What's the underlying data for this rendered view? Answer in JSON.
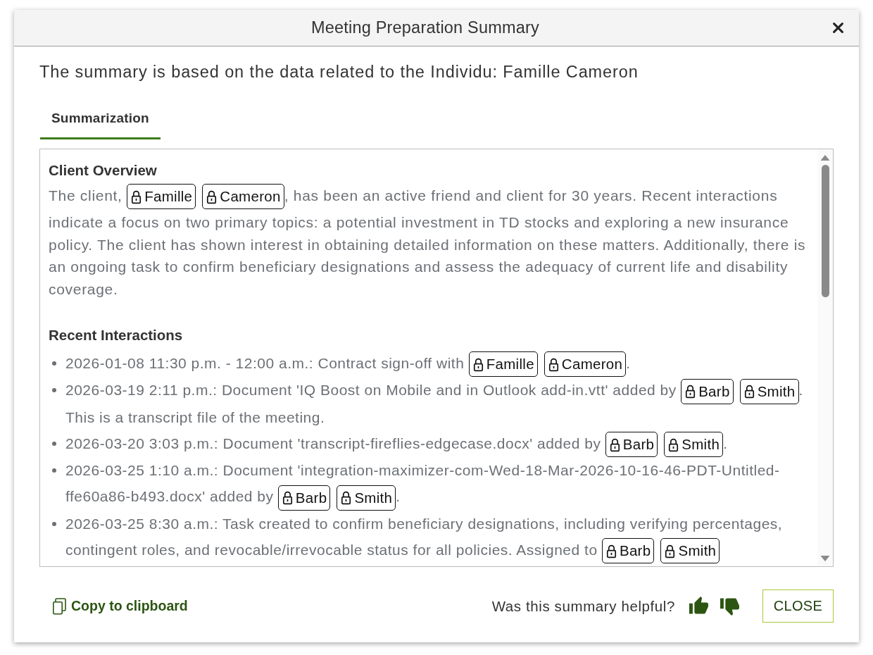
{
  "dialog": {
    "title": "Meeting Preparation Summary"
  },
  "subtitle": "The summary is based on the data related to the Individu: Famille Cameron",
  "tabs": [
    {
      "label": "Summarization",
      "selected": true
    }
  ],
  "summary": {
    "sections": [
      {
        "kind": "paragraph",
        "heading": "Client Overview",
        "parts": [
          {
            "kind": "text",
            "text": "The client, "
          },
          {
            "kind": "tag",
            "text": "Famille"
          },
          {
            "kind": "tag",
            "text": "Cameron"
          },
          {
            "kind": "text",
            "text": ", has been an active friend and client for 30 years. Recent interactions indicate a focus on two primary topics: a potential investment in TD stocks and exploring a new insurance policy. The client has shown interest in obtaining detailed information on these matters. Additionally, there is an ongoing task to confirm beneficiary designations and assess the adequacy of current life and disability coverage."
          }
        ]
      },
      {
        "kind": "list",
        "heading": "Recent Interactions",
        "items": [
          {
            "parts": [
              {
                "kind": "text",
                "text": "2026-01-08 11:30 p.m. - 12:00 a.m.: Contract sign-off with "
              },
              {
                "kind": "tag",
                "text": "Famille"
              },
              {
                "kind": "tag",
                "text": "Cameron"
              },
              {
                "kind": "text",
                "text": "."
              }
            ]
          },
          {
            "parts": [
              {
                "kind": "text",
                "text": "2026-03-19 2:11 p.m.: Document 'IQ Boost on Mobile and in Outlook add-in.vtt' added by "
              },
              {
                "kind": "tag",
                "text": "Barb"
              },
              {
                "kind": "tag",
                "text": "Smith"
              },
              {
                "kind": "text",
                "text": ". This is a transcript file of the meeting."
              }
            ]
          },
          {
            "parts": [
              {
                "kind": "text",
                "text": "2026-03-20 3:03 p.m.: Document 'transcript-fireflies-edgecase.docx' added by "
              },
              {
                "kind": "tag",
                "text": "Barb"
              },
              {
                "kind": "tag",
                "text": "Smith"
              },
              {
                "kind": "text",
                "text": "."
              }
            ]
          },
          {
            "parts": [
              {
                "kind": "text",
                "text": "2026-03-25 1:10 a.m.: Document 'integration-maximizer-com-Wed-18-Mar-2026-10-16-46-PDT-Untitled-ffe60a86-b493.docx' added by "
              },
              {
                "kind": "tag",
                "text": "Barb"
              },
              {
                "kind": "tag",
                "text": "Smith"
              },
              {
                "kind": "text",
                "text": "."
              }
            ]
          },
          {
            "parts": [
              {
                "kind": "text",
                "text": "2026-03-25 8:30 a.m.: Task created to confirm beneficiary designations, including verifying percentages, contingent roles, and revocable/irrevocable status for all policies. Assigned to "
              },
              {
                "kind": "tag",
                "text": "Barb"
              },
              {
                "kind": "tag",
                "text": "Smith"
              }
            ]
          }
        ]
      }
    ]
  },
  "footer": {
    "copy_button": "Copy to clipboard",
    "feedback_prompt": "Was this summary helpful?",
    "close_button": "CLOSE"
  }
}
